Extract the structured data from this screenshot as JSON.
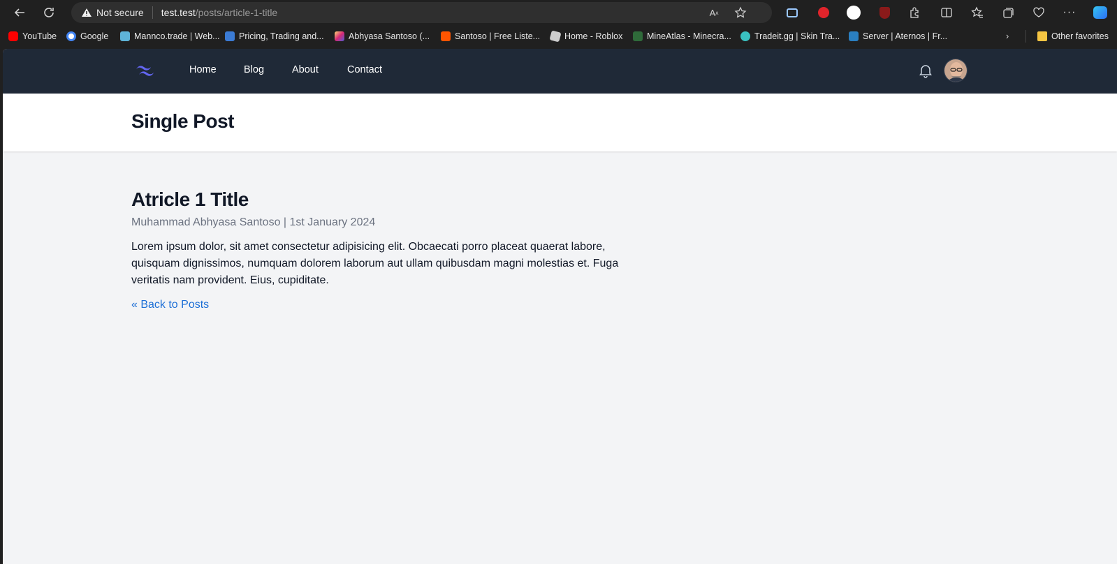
{
  "browser": {
    "security_label": "Not secure",
    "url_host": "test.test",
    "url_path": "/posts/article-1-title",
    "icons": [
      "back-icon",
      "refresh-icon",
      "read-aloud-icon",
      "favorite-star-icon",
      "extension-icon",
      "split-screen-icon",
      "favorites-icon",
      "collections-icon",
      "browser-essentials-icon",
      "more-icon",
      "copilot-icon"
    ]
  },
  "bookmarks": [
    {
      "label": "YouTube",
      "color": "#ff0000"
    },
    {
      "label": "Google",
      "color": "#4285f4"
    },
    {
      "label": "Mannco.trade | Web...",
      "color": "#5fb4d8"
    },
    {
      "label": "Pricing, Trading and...",
      "color": "#3b7bd4"
    },
    {
      "label": "Abhyasa Santoso (...",
      "color": "#d62976"
    },
    {
      "label": "Santoso | Free Liste...",
      "color": "#ff5500"
    },
    {
      "label": "Home - Roblox",
      "color": "#cccccc"
    },
    {
      "label": "MineAtlas - Minecra...",
      "color": "#2f6b3a"
    },
    {
      "label": "Tradeit.gg | Skin Tra...",
      "color": "#3ac0c0"
    },
    {
      "label": "Server | Aternos | Fr...",
      "color": "#2a7fc1"
    }
  ],
  "bookmarks_other": "Other favorites",
  "site": {
    "nav": [
      "Home",
      "Blog",
      "About",
      "Contact"
    ],
    "page_title": "Single Post",
    "article": {
      "title": "Atricle 1 Title",
      "meta": "Muhammad Abhyasa Santoso | 1st January 2024",
      "body": "Lorem ipsum dolor, sit amet consectetur adipisicing elit. Obcaecati porro placeat quaerat labore, quisquam dignissimos, numquam dolorem laborum aut ullam quibusdam magni molestias et. Fuga veritatis nam provident. Eius, cupiditate.",
      "back_link": "« Back to Posts"
    }
  },
  "colors": {
    "nav_bg": "#1f2937",
    "page_bg": "#f3f4f6",
    "link": "#1d6fd6",
    "logo": "#6366f1"
  }
}
